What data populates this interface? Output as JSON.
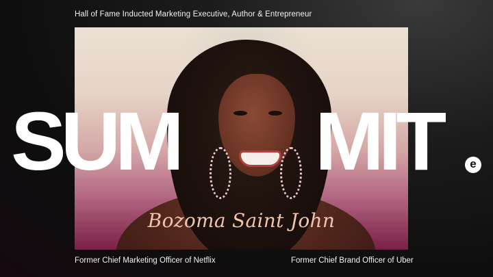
{
  "header": {
    "tagline": "Hall of Fame Inducted Marketing Executive, Author & Entrepreneur"
  },
  "hero": {
    "word_left": "SUM",
    "word_right": "MIT",
    "speaker_name": "Bozoma Saint John",
    "logo_glyph": "e"
  },
  "footer": {
    "role_left": "Former Chief Marketing Officer of Netflix",
    "role_right": "Former Chief Brand Officer of Uber"
  },
  "colors": {
    "background": "#111111",
    "text": "#ffffff",
    "name_accent": "#f1c4b0",
    "photo_top": "#ebe1d4",
    "photo_bottom": "#7a2147"
  }
}
